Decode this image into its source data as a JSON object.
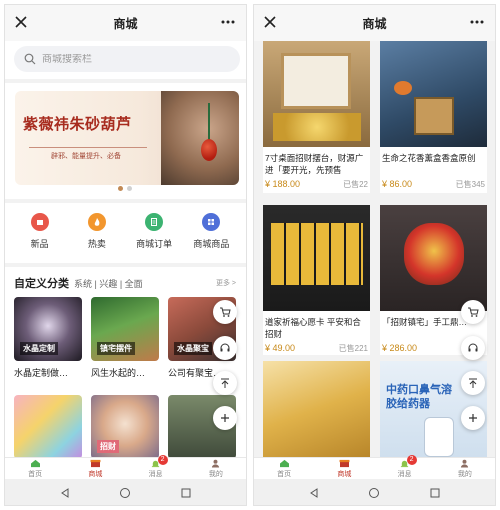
{
  "left": {
    "title": "商城",
    "search_placeholder": "商城搜索栏",
    "banner": {
      "title": "紫薇祎朱砂葫芦",
      "subtitle": "辟邪、能量提升、必备"
    },
    "categories": [
      {
        "label": "新品",
        "color": "#e8574a"
      },
      {
        "label": "热卖",
        "color": "#f2962e"
      },
      {
        "label": "商城订单",
        "color": "#3cb371"
      },
      {
        "label": "商城商品",
        "color": "#4f6fd8"
      }
    ],
    "section": {
      "title": "自定义分类",
      "filters": "系统 | 兴趣 | 全面",
      "more": "更多 >"
    },
    "products": [
      {
        "name": "水晶定制做…",
        "tag": "水晶定制"
      },
      {
        "name": "风生水起的…",
        "tag": "镇宅摆件"
      },
      {
        "name": "公司有聚宝…",
        "tag": "水晶聚宝"
      },
      {
        "name": "",
        "tag": ""
      },
      {
        "name": "",
        "tag": "招财"
      },
      {
        "name": "",
        "tag": ""
      }
    ],
    "tabbar": [
      {
        "label": "首页",
        "icon": "home-icon"
      },
      {
        "label": "商城",
        "icon": "shop-icon",
        "active": true
      },
      {
        "label": "消息",
        "icon": "bell-icon",
        "badge": "2"
      },
      {
        "label": "我的",
        "icon": "user-icon"
      }
    ]
  },
  "right": {
    "title": "商城",
    "items": [
      {
        "name": "7寸桌面招财摆台，财源广进「要开光，先预售",
        "price": "¥ 188.00",
        "sold": "已售22",
        "img_text": "财源广进\n日进斗金"
      },
      {
        "name": "生命之花香薰盒香盒原创",
        "price": "¥ 86.00",
        "sold": "已售345",
        "img_text": ""
      },
      {
        "name": "道家祈福心愿卡 平安和合招财",
        "price": "¥ 49.00",
        "sold": "已售221",
        "img_text": ""
      },
      {
        "name": "「招财镇宅」手工鼎…",
        "price": "¥ 286.00",
        "sold": "",
        "img_text": ""
      },
      {
        "name": "",
        "price": "",
        "sold": "",
        "img_text": ""
      },
      {
        "name": "",
        "price": "",
        "sold": "",
        "img_text": "中药口鼻气溶胶给药器"
      }
    ],
    "tabbar": [
      {
        "label": "首页",
        "icon": "home-icon"
      },
      {
        "label": "商城",
        "icon": "shop-icon",
        "active": true
      },
      {
        "label": "消息",
        "icon": "bell-icon",
        "badge": "2"
      },
      {
        "label": "我的",
        "icon": "user-icon"
      }
    ]
  },
  "colors": {
    "accent_price": "#c88a1a",
    "badge": "#e53935",
    "active_tab": "#c0392b"
  }
}
